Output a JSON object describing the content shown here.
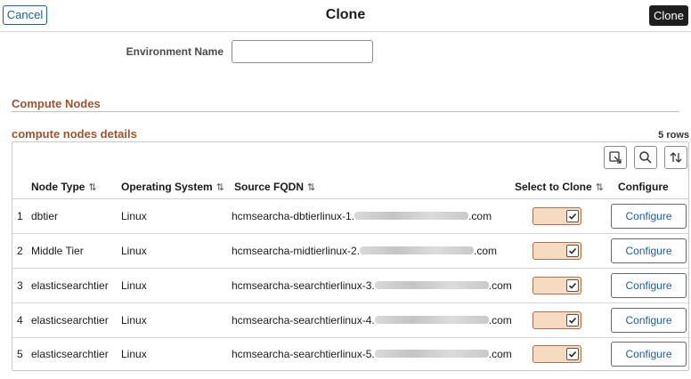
{
  "header": {
    "cancel_label": "Cancel",
    "title": "Clone",
    "clone_label": "Clone"
  },
  "form": {
    "env_name_label": "Environment Name",
    "env_name_value": ""
  },
  "section": {
    "title": "Compute Nodes"
  },
  "grid": {
    "title": "compute nodes details",
    "row_count": "5 rows",
    "columns": {
      "node_type": "Node Type",
      "os": "Operating System",
      "fqdn": "Source FQDN",
      "select": "Select to Clone",
      "configure": "Configure"
    },
    "sort_glyph": "⇅",
    "rows": [
      {
        "num": "1",
        "node_type": "dbtier",
        "os": "Linux",
        "fqdn_prefix": "hcmsearcha-dbtierlinux-1.",
        "fqdn_suffix": ".com",
        "selected": true,
        "configure_label": "Configure"
      },
      {
        "num": "2",
        "node_type": "Middle Tier",
        "os": "Linux",
        "fqdn_prefix": "hcmsearcha-midtierlinux-2.",
        "fqdn_suffix": ".com",
        "selected": true,
        "configure_label": "Configure"
      },
      {
        "num": "3",
        "node_type": "elasticsearchtier",
        "os": "Linux",
        "fqdn_prefix": "hcmsearcha-searchtierlinux-3.",
        "fqdn_suffix": ".com",
        "selected": true,
        "configure_label": "Configure"
      },
      {
        "num": "4",
        "node_type": "elasticsearchtier",
        "os": "Linux",
        "fqdn_prefix": "hcmsearcha-searchtierlinux-4.",
        "fqdn_suffix": ".com",
        "selected": true,
        "configure_label": "Configure"
      },
      {
        "num": "5",
        "node_type": "elasticsearchtier",
        "os": "Linux",
        "fqdn_prefix": "hcmsearcha-searchtierlinux-5.",
        "fqdn_suffix": ".com",
        "selected": true,
        "configure_label": "Configure"
      }
    ]
  },
  "icons": {
    "export": "export-icon",
    "search": "search-icon",
    "sort": "sort-icon",
    "check": "check-icon"
  },
  "colors": {
    "section_title": "#a0522d",
    "link_blue": "#1a5fa8",
    "toggle_fill": "#f5dcc0",
    "clone_button": "#1e1e1e"
  }
}
